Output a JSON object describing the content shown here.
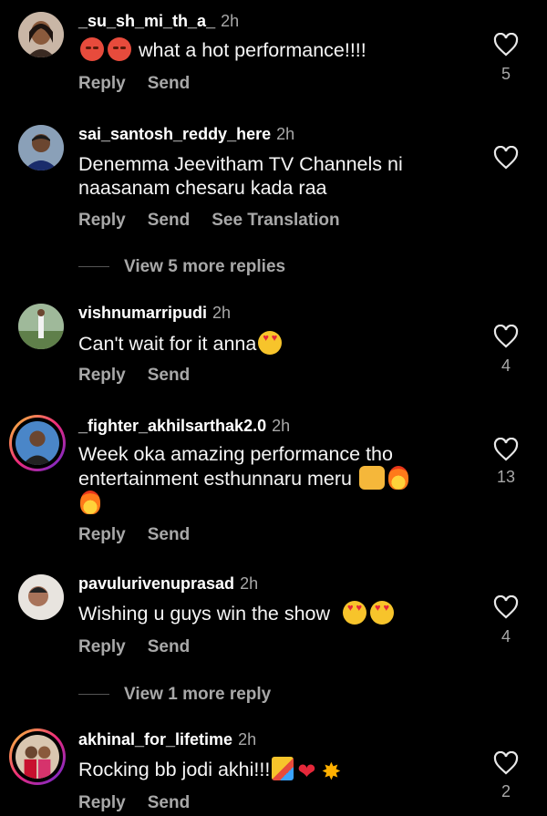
{
  "comments": [
    {
      "username": "_su_sh_mi_th_a_",
      "time": "2h",
      "text": "what a hot performance!!!!",
      "likes": "5",
      "reply": "Reply",
      "send": "Send"
    },
    {
      "username": "sai_santosh_reddy_here",
      "time": "2h",
      "text_line1": "Denemma Jeevitham TV Channels ni",
      "text_line2": "naasanam chesaru kada raa",
      "reply": "Reply",
      "send": "Send",
      "translate": "See Translation"
    },
    {
      "username": "vishnumarripudi",
      "time": "2h",
      "text": "Can't wait for it anna",
      "likes": "4",
      "reply": "Reply",
      "send": "Send"
    },
    {
      "username": "_fighter_akhilsarthak2.0",
      "time": "2h",
      "text_line1": "Week oka amazing performance tho",
      "text_line2": "entertainment esthunnaru meru",
      "likes": "13",
      "reply": "Reply",
      "send": "Send"
    },
    {
      "username": "pavulurivenuprasad",
      "time": "2h",
      "text": "Wishing u guys win the show",
      "likes": "4",
      "reply": "Reply",
      "send": "Send"
    },
    {
      "username": "akhinal_for_lifetime",
      "time": "2h",
      "text": "Rocking bb jodi akhi!!!",
      "likes": "2",
      "reply": "Reply",
      "send": "Send"
    }
  ],
  "view_more_1": "View 5 more replies",
  "view_more_2": "View 1 more reply",
  "colors": {
    "background": "#000000",
    "secondary_text": "#a8a8a8",
    "primary_text": "#ffffff"
  },
  "icons": {
    "like": "heart-outline-icon"
  }
}
